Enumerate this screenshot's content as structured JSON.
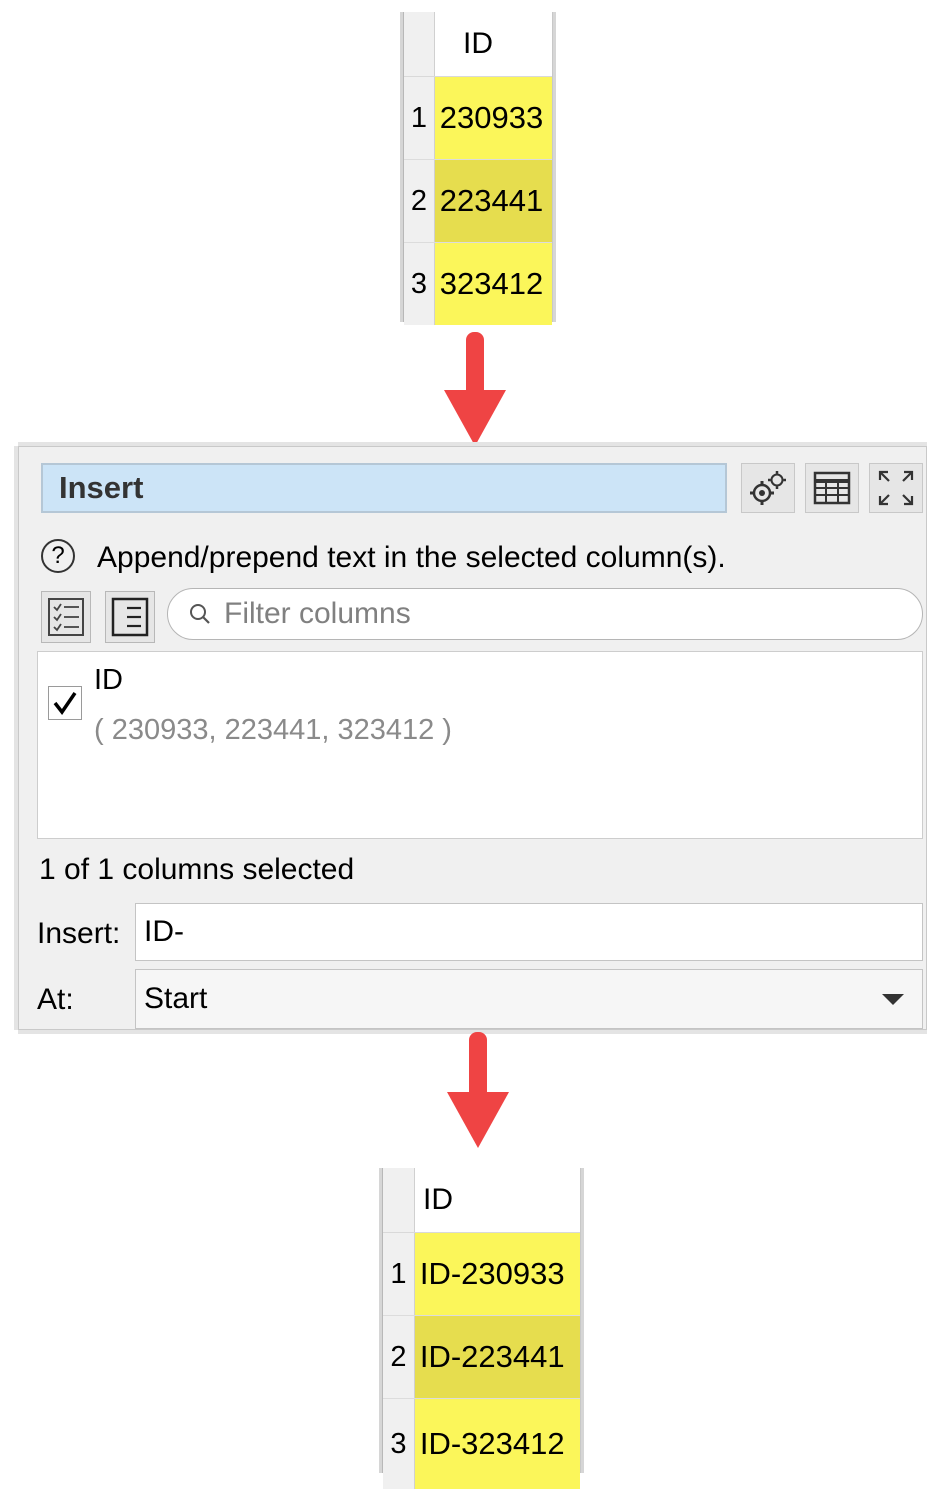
{
  "input_table": {
    "column_header": "ID",
    "rows": [
      {
        "num": "1",
        "value": "230933"
      },
      {
        "num": "2",
        "value": "223441"
      },
      {
        "num": "3",
        "value": "323412"
      }
    ]
  },
  "panel": {
    "title": "Insert",
    "toolbar_icons": [
      "gears-icon",
      "table-icon",
      "maximize-icon"
    ],
    "help_glyph": "?",
    "description": "Append/prepend text in the selected column(s).",
    "filter_placeholder": "Filter columns",
    "column_item": {
      "name": "ID",
      "sample_values": "( 230933, 223441, 323412 )",
      "checked": true
    },
    "selection_status": "1 of 1 columns selected",
    "insert_label": "Insert:",
    "insert_value": "ID-",
    "at_label": "At:",
    "at_value": "Start"
  },
  "output_table": {
    "column_header": "ID",
    "rows": [
      {
        "num": "1",
        "value": "ID-230933"
      },
      {
        "num": "2",
        "value": "ID-223441"
      },
      {
        "num": "3",
        "value": "ID-323412"
      }
    ]
  },
  "colors": {
    "arrow": "#ef4444",
    "cell_yellow": "#fbf65a",
    "cell_yellow_alt": "#e6dd4e",
    "title_bg": "#cce4f7"
  }
}
